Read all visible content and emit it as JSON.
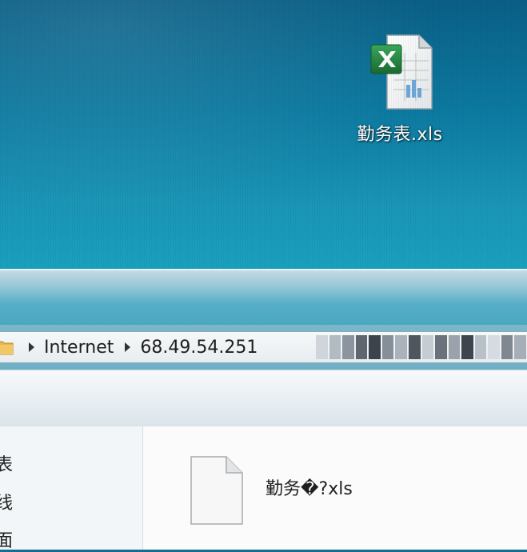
{
  "desktop": {
    "icon": {
      "name": "excel-xls-file-icon",
      "label": "勤务表.xls"
    }
  },
  "explorer": {
    "address_bar": {
      "breadcrumbs": [
        "Internet",
        "68.49.54.251"
      ],
      "obscured_segment": "pixelated"
    },
    "nav_pane": {
      "partial_items": [
        "表",
        "线",
        "面"
      ]
    },
    "files": [
      {
        "name": "勤务�?xls",
        "icon": "blank-file-icon"
      }
    ]
  },
  "colors": {
    "desktop_background": "#0c79a0",
    "excel_green": "#1f7a3a",
    "window_glass": "#57aec6"
  }
}
